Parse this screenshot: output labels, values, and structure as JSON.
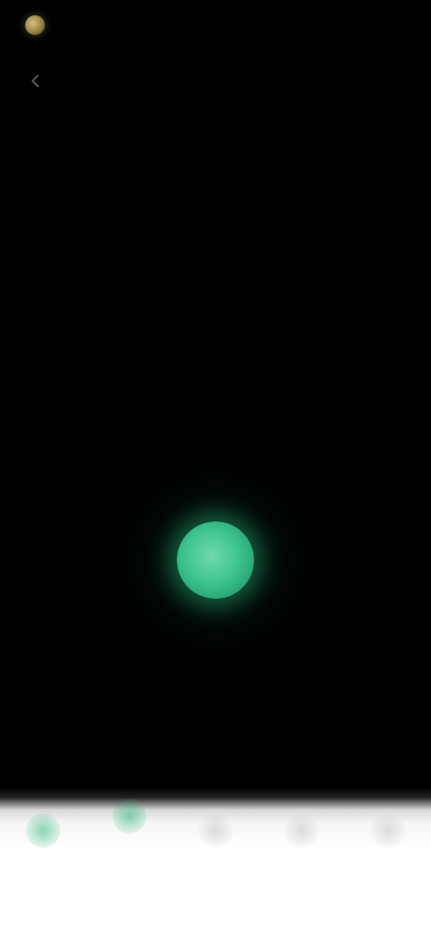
{
  "status_bar": {
    "text": ""
  },
  "nav": {
    "title": "",
    "back_icon": "chevron-left-icon"
  },
  "hero": {
    "title": "",
    "subtitle": ""
  },
  "mic": {
    "icon": "microphone-icon",
    "label": ""
  },
  "disclaimer": "",
  "bottom_nav": {
    "items": [
      {
        "icon": "home-icon",
        "label": "",
        "active": true
      },
      {
        "icon": "voice-icon",
        "label": "",
        "active": true
      },
      {
        "icon": "search-icon",
        "label": "",
        "active": false
      },
      {
        "icon": "chart-icon",
        "label": "",
        "active": false
      },
      {
        "icon": "profile-icon",
        "label": "",
        "active": false
      }
    ]
  },
  "colors": {
    "background": "#000000",
    "accent_green": "#3ec48e",
    "nav_background": "#ffffff"
  }
}
